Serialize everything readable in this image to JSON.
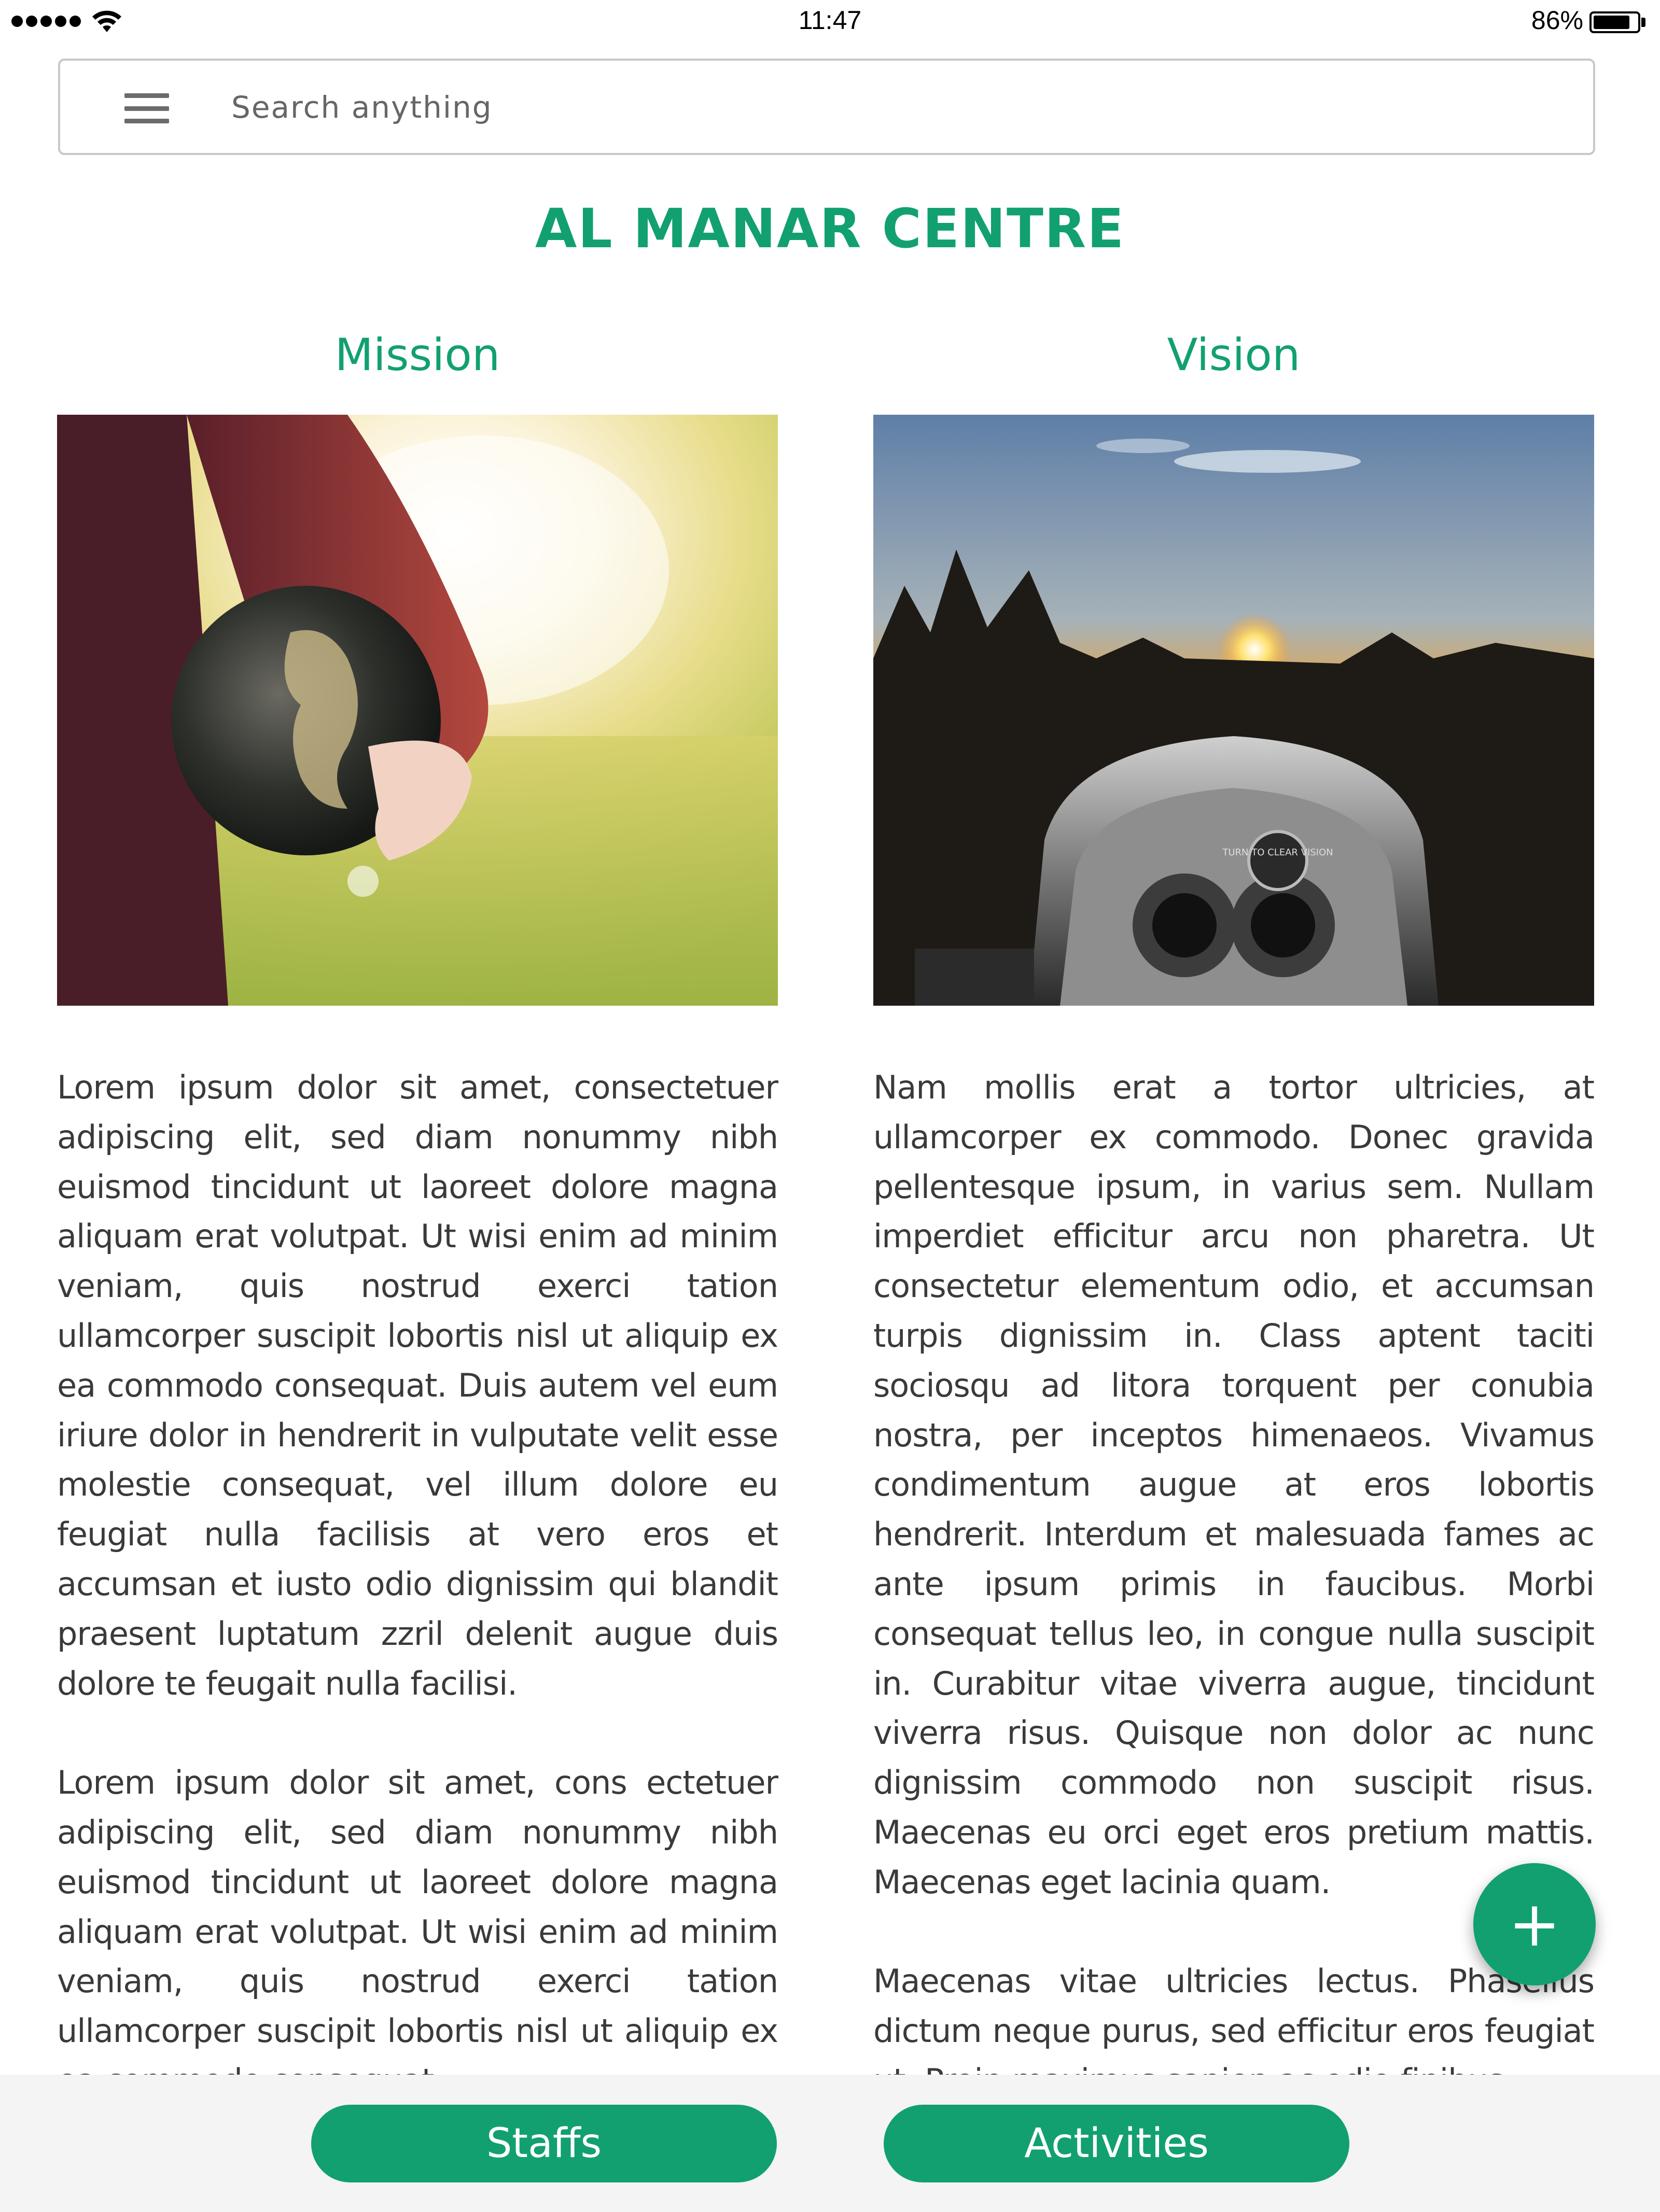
{
  "status_bar": {
    "time": "11:47",
    "battery_percent": "86%",
    "battery_level": 0.86,
    "signal_bars": 5
  },
  "search": {
    "placeholder": "Search anything",
    "menu_icon": "hamburger-menu-icon"
  },
  "page": {
    "title": "AL MANAR CENTRE"
  },
  "mission": {
    "heading": "Mission",
    "paragraphs": [
      "Lorem ipsum dolor sit amet, consectetuer adipiscing elit, sed diam nonummy nibh euismod tincidunt ut laoreet dolore magna aliquam erat volutpat. Ut wisi enim ad minim veniam, quis nostrud exerci tation ullamcorper suscipit lobortis nisl ut aliquip ex ea commodo consequat. Duis autem vel eum iriure dolor in hendrerit in vulputate velit esse molestie consequat, vel illum dolore eu feugiat nulla facilisis at vero eros et accumsan et iusto odio dignissim qui blandit praesent luptatum zzril delenit augue duis dolore te feugait nulla facilisi.",
      "Lorem ipsum dolor sit amet, cons ectetuer adipiscing elit, sed diam nonummy nibh euismod tincidunt ut laoreet dolore magna aliquam erat volutpat. Ut wisi enim ad minim veniam, quis nostrud exerci tation ullamcorper suscipit lobortis nisl ut aliquip ex ea commodo consequat."
    ]
  },
  "vision": {
    "heading": "Vision",
    "binocular_label": "TURN TO CLEAR VISION",
    "paragraphs": [
      "Nam mollis erat a tortor ultricies, at ullamcorper ex commodo. Donec gravida pellentesque ipsum, in varius sem. Nullam imperdiet efficitur arcu non pharetra. Ut consectetur elementum odio, et accumsan turpis dignissim in. Class aptent taciti sociosqu ad litora torquent per conubia nostra, per inceptos himenaeos. Vivamus condimentum augue at eros lobortis hendrerit. Interdum et malesuada fames ac ante ipsum primis in faucibus. Morbi consequat tellus leo, in congue nulla suscipit in. Curabitur vitae viverra augue, tincidunt viverra risus. Quisque non dolor ac nunc dignissim commodo non suscipit risus. Maecenas eu orci eget eros pretium mattis. Maecenas eget lacinia quam.",
      "Maecenas vitae ultricies lectus. Phasellus dictum neque purus, sed efficitur eros feugiat ut. Proin maximus sapien ac odio finibus."
    ]
  },
  "fab": {
    "label": "+",
    "icon": "plus-icon"
  },
  "bottom_bar": {
    "staffs_label": "Staffs",
    "activities_label": "Activities"
  },
  "colors": {
    "accent": "#12a071",
    "bottom_bar_bg": "#f4f4f4",
    "search_border": "#c8c8c8"
  }
}
